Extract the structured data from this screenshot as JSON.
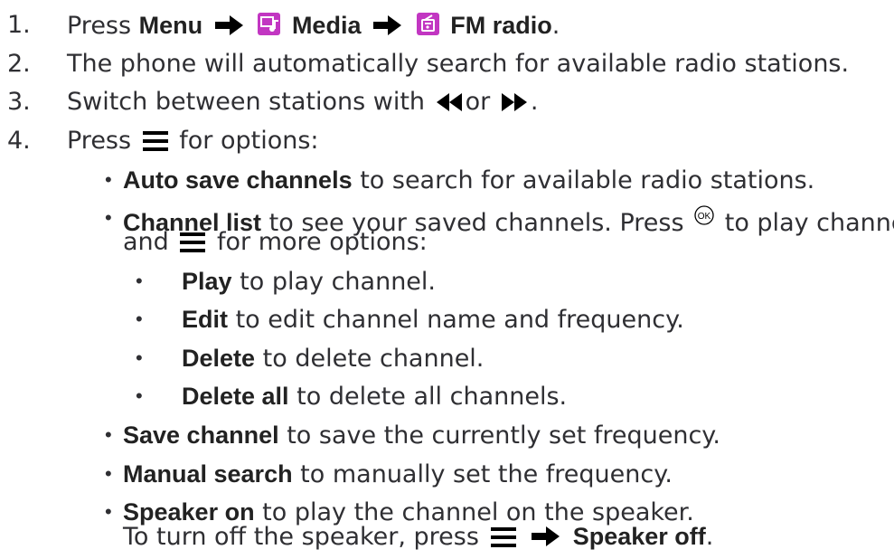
{
  "steps": [
    {
      "num": "1.",
      "press": "Press",
      "menu": "Menu",
      "media": "Media",
      "fm": "FM radio",
      "end": "."
    },
    {
      "num": "2.",
      "text": "The phone will automatically search for available radio stations."
    },
    {
      "num": "3.",
      "text_a": "Switch between stations with",
      "or": "or",
      "end": "."
    },
    {
      "num": "4.",
      "press": "Press",
      "text": "for options:"
    }
  ],
  "options": [
    {
      "bold": "Auto save channels",
      "text": "to search for available radio stations."
    },
    {
      "bold": "Channel list",
      "text_a": "to see your saved channels. Press",
      "text_b": "to play channel",
      "line2_a": "and",
      "line2_b": "for more options:"
    },
    {
      "bold": "Save channel",
      "text": "to save the currently set frequency."
    },
    {
      "bold": "Manual search",
      "text": "to manually set the frequency."
    },
    {
      "bold": "Speaker on",
      "text": "to play the channel on the speaker.",
      "line2_a": "To turn off the speaker, press",
      "line2_bold": "Speaker off",
      "line2_end": "."
    }
  ],
  "sub_options": [
    {
      "bold": "Play",
      "text": "to play channel."
    },
    {
      "bold": "Edit",
      "text": "to edit channel name and frequency."
    },
    {
      "bold": "Delete",
      "text": "to delete channel."
    },
    {
      "bold": "Delete all",
      "text": "to delete all channels."
    }
  ],
  "bullet": "•",
  "colors": {
    "text": "#2f2f33",
    "bold": "#222222",
    "app_icon": "#c236c2"
  },
  "icons": {
    "arrow": "right-arrow-icon",
    "media": "media-app-icon",
    "fm": "fm-radio-app-icon",
    "menu": "menu-lines-icon",
    "rewind": "rewind-icon",
    "forward": "fast-forward-icon",
    "ok": "ok-key-icon"
  }
}
